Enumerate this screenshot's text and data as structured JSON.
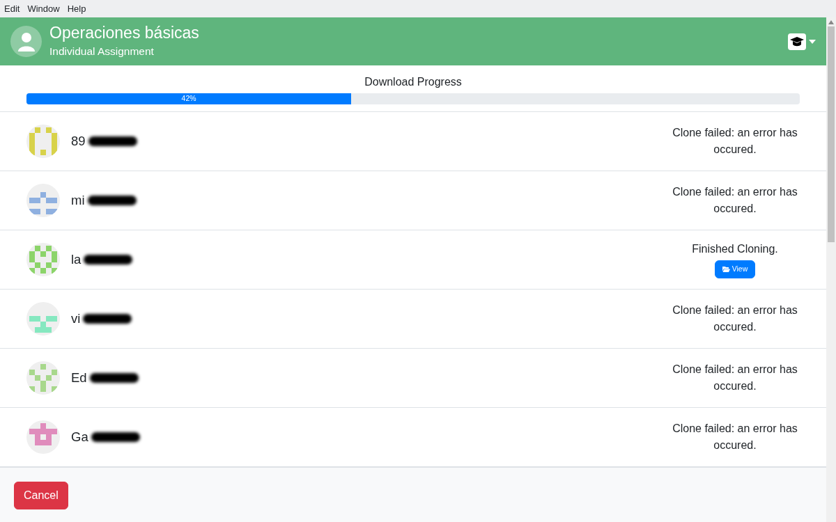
{
  "menu": [
    "Edit",
    "Window",
    "Help"
  ],
  "header": {
    "title": "Operaciones básicas",
    "subtitle": "Individual Assignment"
  },
  "progress": {
    "title": "Download Progress",
    "level": 0.42,
    "label": "42%"
  },
  "students": [
    {
      "name": "89",
      "color": "#d8d24a",
      "status": {
        "kind": "failed",
        "text": "Clone failed: an error has occured."
      }
    },
    {
      "name": "mi",
      "color": "#8fb0e0",
      "status": {
        "kind": "failed",
        "text": "Clone failed: an error has occured."
      }
    },
    {
      "name": "la",
      "color": "#8cd46a",
      "status": {
        "kind": "finished",
        "text": "Finished Cloning.",
        "button": "View"
      }
    },
    {
      "name": "vi",
      "color": "#86e8c0",
      "status": {
        "kind": "failed",
        "text": "Clone failed: an error has occured."
      }
    },
    {
      "name": "Ed",
      "color": "#a8d88c",
      "status": {
        "kind": "failed",
        "text": "Clone failed: an error has occured."
      }
    },
    {
      "name": "Ga",
      "color": "#e08cbc",
      "status": {
        "kind": "failed",
        "text": "Clone failed: an error has occured."
      }
    }
  ],
  "cancel": "Cancel"
}
